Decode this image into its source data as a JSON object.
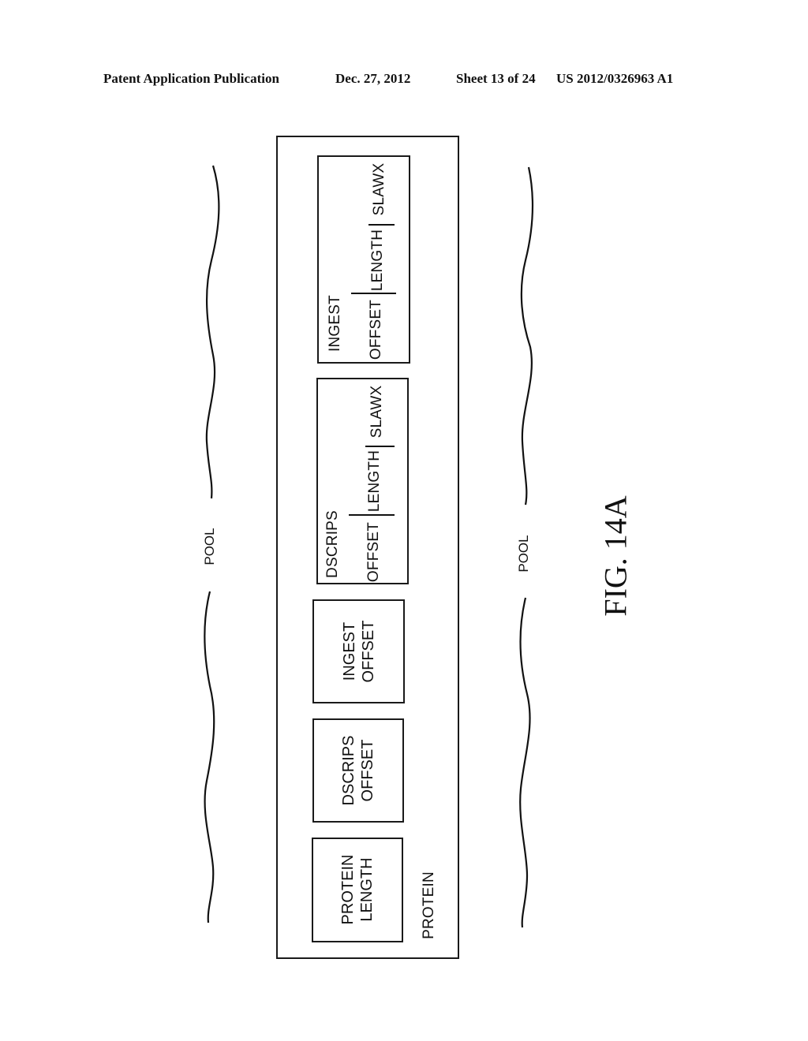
{
  "header": {
    "publication": "Patent Application Publication",
    "date": "Dec. 27, 2012",
    "sheet": "Sheet 13 of 24",
    "number": "US 2012/0326963 A1"
  },
  "figure": {
    "caption": "FIG. 14A",
    "pool_labels": [
      "POOL",
      "POOL"
    ],
    "protein": {
      "label": "PROTEIN",
      "fields": [
        {
          "line1": "PROTEIN",
          "line2": "LENGTH"
        },
        {
          "line1": "DSCRIPS",
          "line2": "OFFSET"
        },
        {
          "line1": "INGEST",
          "line2": "OFFSET"
        }
      ],
      "sections": [
        {
          "title": "DSCRIPS",
          "parts": [
            "OFFSET",
            "LENGTH",
            "SLAWX"
          ]
        },
        {
          "title": "INGEST",
          "parts": [
            "OFFSET",
            "LENGTH",
            "SLAWX"
          ]
        }
      ]
    }
  }
}
